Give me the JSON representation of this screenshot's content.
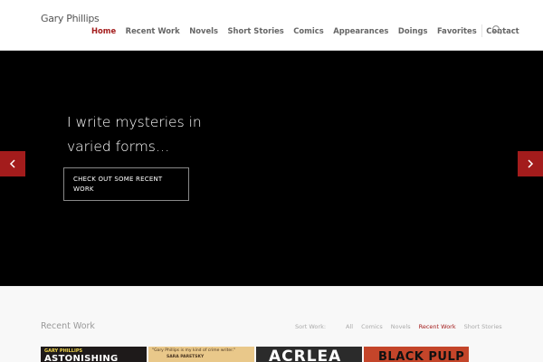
{
  "site": {
    "logo": "Gary Phillips"
  },
  "nav": {
    "items": [
      {
        "label": "Home",
        "active": true
      },
      {
        "label": "Recent Work"
      },
      {
        "label": "Novels"
      },
      {
        "label": "Short Stories"
      },
      {
        "label": "Comics"
      },
      {
        "label": "Appearances"
      },
      {
        "label": "Doings"
      },
      {
        "label": "Favorites"
      },
      {
        "label": "Contact"
      }
    ],
    "search_icon": "search-icon"
  },
  "hero": {
    "text": "I write mysteries in varied forms…",
    "button_label": "CHECK OUT SOME RECENT WORK",
    "prev_icon": "chevron-left-icon",
    "next_icon": "chevron-right-icon"
  },
  "recent_work": {
    "title": "Recent Work",
    "sort_label": "Sort Work:",
    "filters": [
      {
        "label": "All"
      },
      {
        "label": "Comics"
      },
      {
        "label": "Novels"
      },
      {
        "label": "Recent Work",
        "active": true
      },
      {
        "label": "Short Stories"
      }
    ],
    "thumbnails": [
      {
        "top_text": "GARY PHILLIPS",
        "main_text": "ASTONISHING",
        "bg": "#1e1a1a",
        "fg1": "#f2d64a",
        "fg2": "#ffffff"
      },
      {
        "top_text": "\"Gary Phillips is my kind of crime writer.\"",
        "main_text": "SARA PARETSKY",
        "bg": "#e9c88a",
        "fg1": "#4a3520",
        "fg2": "#4a3520"
      },
      {
        "top_text": "",
        "main_text": "ACRLEA",
        "bg": "#2b2b2b",
        "fg1": "#ffffff",
        "fg2": "#ffffff"
      },
      {
        "top_text": "",
        "main_text": "BLACK PULP",
        "bg": "#c4452a",
        "fg1": "#111111",
        "fg2": "#111111"
      }
    ]
  },
  "colors": {
    "accent": "#a31c1c",
    "hero_bg": "#000000",
    "section_bg": "#f8f8f8"
  }
}
